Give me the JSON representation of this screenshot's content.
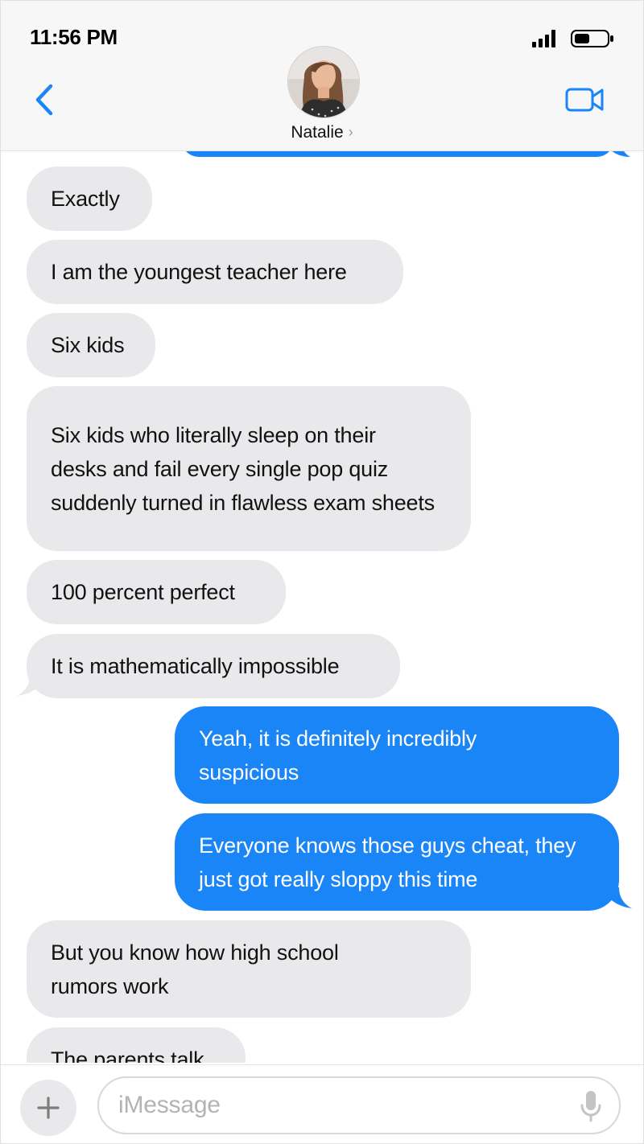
{
  "status_bar": {
    "time": "11:56 PM"
  },
  "header": {
    "contact_name": "Natalie",
    "chevron": "›",
    "back_icon": "chevron-left-icon",
    "video_icon": "video-camera-icon"
  },
  "colors": {
    "accent": "#1a85f7",
    "incoming_bubble": "#e9e9eb",
    "header_bg": "#f7f7f7"
  },
  "messages": [
    {
      "direction": "in",
      "text": "Exactly"
    },
    {
      "direction": "in",
      "text": "I am the youngest teacher here"
    },
    {
      "direction": "in",
      "text": "Six kids"
    },
    {
      "direction": "in",
      "text": "Six kids who literally sleep on their desks and fail every single pop quiz suddenly turned in flawless exam sheets"
    },
    {
      "direction": "in",
      "text": "100 percent perfect"
    },
    {
      "direction": "in",
      "text": "It is mathematically impossible"
    },
    {
      "direction": "out",
      "text": "Yeah, it is definitely incredibly suspicious"
    },
    {
      "direction": "out",
      "text": "Everyone knows those guys cheat, they just got really sloppy this time"
    },
    {
      "direction": "in",
      "text": "But you know how high school rumors work"
    },
    {
      "direction": "in",
      "text": "The parents talk"
    }
  ],
  "composer": {
    "placeholder": "iMessage",
    "plus_icon": "plus-icon",
    "mic_icon": "microphone-icon"
  }
}
